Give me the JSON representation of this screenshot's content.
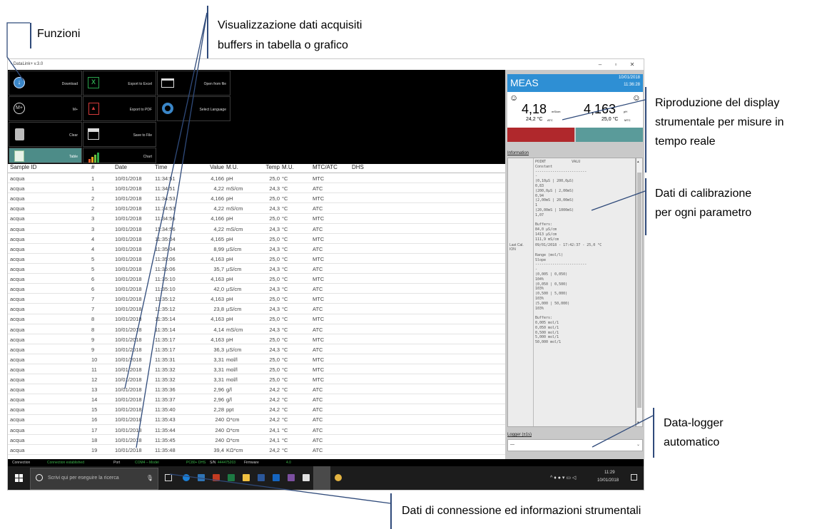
{
  "annotations": {
    "funzioni": "Funzioni",
    "visualizzazione_l1": "Visualizzazione dati acquisiti",
    "visualizzazione_l2": "buffers in tabella o grafico",
    "riproduzione_l1": "Riproduzione del display",
    "riproduzione_l2": "strumentale per misure in",
    "riproduzione_l3": "tempo reale",
    "calibrazione_l1": "Dati di calibrazione",
    "calibrazione_l2": "per ogni parametro",
    "datalogger_l1": "Data-logger",
    "datalogger_l2": "automatico",
    "connessione": "Dati di connessione ed informazioni strumentali"
  },
  "window": {
    "title": "DataLink+ v.3.0",
    "minimize": "–",
    "maximize": "▫",
    "close": "✕"
  },
  "buttons": {
    "download": "Download",
    "export_excel": "Export to Excel",
    "open_file": "Open from file",
    "m_plus": "M+",
    "export_pdf": "Export to PDF",
    "select_language": "Select Language",
    "clear": "Clear",
    "save_file": "Save to File",
    "table": "Table",
    "chart": "Chart"
  },
  "table": {
    "headers": {
      "sample": "Sample ID",
      "num": "#",
      "date": "Date",
      "time": "Time",
      "value": "Value",
      "mu": "M.U.",
      "temp": "Temp",
      "tmu": "M.U.",
      "mtc": "MTC/ATC",
      "dhs": "DHS"
    },
    "rows": [
      [
        "acqua",
        "1",
        "10/01/2018",
        "11:34:51",
        "4,166",
        "pH",
        "25,0",
        "°C",
        "MTC"
      ],
      [
        "acqua",
        "1",
        "10/01/2018",
        "11:34:51",
        "4,22",
        "mS/cm",
        "24,3",
        "°C",
        "ATC"
      ],
      [
        "acqua",
        "2",
        "10/01/2018",
        "11:34:53",
        "4,166",
        "pH",
        "25,0",
        "°C",
        "MTC"
      ],
      [
        "acqua",
        "2",
        "10/01/2018",
        "11:34:53",
        "4,22",
        "mS/cm",
        "24,3",
        "°C",
        "ATC"
      ],
      [
        "acqua",
        "3",
        "10/01/2018",
        "11:34:56",
        "4,166",
        "pH",
        "25,0",
        "°C",
        "MTC"
      ],
      [
        "acqua",
        "3",
        "10/01/2018",
        "11:34:56",
        "4,22",
        "mS/cm",
        "24,3",
        "°C",
        "ATC"
      ],
      [
        "acqua",
        "4",
        "10/01/2018",
        "11:35:04",
        "4,165",
        "pH",
        "25,0",
        "°C",
        "MTC"
      ],
      [
        "acqua",
        "4",
        "10/01/2018",
        "11:35:04",
        "8,99",
        "µS/cm",
        "24,3",
        "°C",
        "ATC"
      ],
      [
        "acqua",
        "5",
        "10/01/2018",
        "11:35:06",
        "4,163",
        "pH",
        "25,0",
        "°C",
        "MTC"
      ],
      [
        "acqua",
        "5",
        "10/01/2018",
        "11:35:06",
        "35,7",
        "µS/cm",
        "24,3",
        "°C",
        "ATC"
      ],
      [
        "acqua",
        "6",
        "10/01/2018",
        "11:35:10",
        "4,163",
        "pH",
        "25,0",
        "°C",
        "MTC"
      ],
      [
        "acqua",
        "6",
        "10/01/2018",
        "11:35:10",
        "42,0",
        "µS/cm",
        "24,3",
        "°C",
        "ATC"
      ],
      [
        "acqua",
        "7",
        "10/01/2018",
        "11:35:12",
        "4,163",
        "pH",
        "25,0",
        "°C",
        "MTC"
      ],
      [
        "acqua",
        "7",
        "10/01/2018",
        "11:35:12",
        "23,8",
        "µS/cm",
        "24,3",
        "°C",
        "ATC"
      ],
      [
        "acqua",
        "8",
        "10/01/2018",
        "11:35:14",
        "4,163",
        "pH",
        "25,0",
        "°C",
        "MTC"
      ],
      [
        "acqua",
        "8",
        "10/01/2018",
        "11:35:14",
        "4,14",
        "mS/cm",
        "24,3",
        "°C",
        "ATC"
      ],
      [
        "acqua",
        "9",
        "10/01/2018",
        "11:35:17",
        "4,163",
        "pH",
        "25,0",
        "°C",
        "MTC"
      ],
      [
        "acqua",
        "9",
        "10/01/2018",
        "11:35:17",
        "36,3",
        "µS/cm",
        "24,3",
        "°C",
        "ATC"
      ],
      [
        "acqua",
        "10",
        "10/01/2018",
        "11:35:31",
        "3,31",
        "mol/l",
        "25,0",
        "°C",
        "MTC"
      ],
      [
        "acqua",
        "11",
        "10/01/2018",
        "11:35:32",
        "3,31",
        "mol/l",
        "25,0",
        "°C",
        "MTC"
      ],
      [
        "acqua",
        "12",
        "10/01/2018",
        "11:35:32",
        "3,31",
        "mol/l",
        "25,0",
        "°C",
        "MTC"
      ],
      [
        "acqua",
        "13",
        "10/01/2018",
        "11:35:36",
        "2,96",
        "g/l",
        "24,2",
        "°C",
        "ATC"
      ],
      [
        "acqua",
        "14",
        "10/01/2018",
        "11:35:37",
        "2,96",
        "g/l",
        "24,2",
        "°C",
        "ATC"
      ],
      [
        "acqua",
        "15",
        "10/01/2018",
        "11:35:40",
        "2,28",
        "ppt",
        "24,2",
        "°C",
        "ATC"
      ],
      [
        "acqua",
        "16",
        "10/01/2018",
        "11:35:43",
        "240",
        "Ω*cm",
        "24,2",
        "°C",
        "ATC"
      ],
      [
        "acqua",
        "17",
        "10/01/2018",
        "11:35:44",
        "240",
        "Ω*cm",
        "24,1",
        "°C",
        "ATC"
      ],
      [
        "acqua",
        "18",
        "10/01/2018",
        "11:35:45",
        "240",
        "Ω*cm",
        "24,1",
        "°C",
        "ATC"
      ],
      [
        "acqua",
        "19",
        "10/01/2018",
        "11:35:48",
        "39,4",
        "KΩ*cm",
        "24,2",
        "°C",
        "ATC"
      ]
    ]
  },
  "meas": {
    "label": "MEAS",
    "date": "10/01/2018",
    "time": "11:36:28",
    "left_value": "4,18",
    "left_unit": "mS/cm",
    "left_temp": "24,2 °C",
    "left_mode": "ATC",
    "right_value": "4,163",
    "right_unit": "pH",
    "right_temp": "25,0 °C",
    "right_mode": "MTC",
    "left_bar_color": "#b0282c",
    "right_bar_color": "#5a9b9a"
  },
  "info": {
    "heading": "Information",
    "lastcal_label_1": "Last Cal.",
    "lastcal_label_2": "ION",
    "lines_top": [
      "POINT            VALU",
      "Constant",
      "------------------------",
      "-",
      "(0,10µS | 200,0µS)",
      "0,83",
      "(200,0µS | 2,00mS)",
      "0,94",
      "(2,00mS | 20,00mS)",
      "1",
      "(20,00mS | 1000mS)",
      "1,07",
      "",
      "Buffers:",
      "84,0 µS/cm",
      "1413 µS/cm",
      "111,9 mS/cm"
    ],
    "lastcal_line": "09/01/2018 - 17:42:37 - 25,0 °C",
    "lines_bottom": [
      "",
      "Range (mol/l)",
      "Slope",
      "------------------------",
      "-",
      "(0,005 | 0,050)",
      "104%",
      "(0,050 | 0,500)",
      "103%",
      "(0,500 | 5,000)",
      "103%",
      "(5,000 | 50,000)",
      "103%",
      "",
      "Buffers:",
      "0,005 mol/1",
      "0,050 mol/1",
      "0,500 mol/1",
      "5,000 mol/1",
      "50,000 mol/1"
    ]
  },
  "logger": {
    "label": "Logger (±1s)",
    "value": "---"
  },
  "status": {
    "connection_label": "Connection",
    "connection_value": "Connection established",
    "port_label": "Port",
    "port_value": "COM4 – Model",
    "model_value": "PC80+ DHS",
    "sn_label": "S/N",
    "sn_value": "444475203",
    "firmware_label": "Firmware",
    "firmware_value": "4.0"
  },
  "taskbar": {
    "search_placeholder": "Scrivi qui per eseguire la ricerca",
    "clock_time": "11:29",
    "clock_date": "10/01/2018"
  }
}
